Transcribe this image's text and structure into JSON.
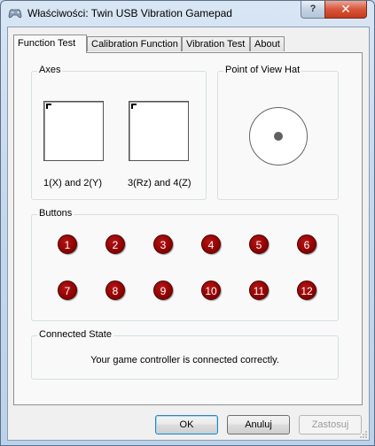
{
  "window": {
    "title": "Właściwości: Twin USB Vibration Gamepad",
    "help_label": "?",
    "close_label": "✕"
  },
  "tabs": [
    {
      "label": "Function Test",
      "active": true
    },
    {
      "label": "Calibration Function",
      "active": false
    },
    {
      "label": "Vibration Test",
      "active": false
    },
    {
      "label": "About",
      "active": false
    }
  ],
  "axes": {
    "title": "Axes",
    "axis1_label": "1(X) and 2(Y)",
    "axis2_label": "3(Rz) and 4(Z)"
  },
  "pov": {
    "title": "Point of View Hat"
  },
  "buttons": {
    "title": "Buttons",
    "items": [
      "1",
      "2",
      "3",
      "4",
      "5",
      "6",
      "7",
      "8",
      "9",
      "10",
      "11",
      "12"
    ]
  },
  "connected": {
    "title": "Connected State",
    "message": "Your game controller is connected correctly."
  },
  "footer": {
    "ok_label": "OK",
    "cancel_label": "Anuluj",
    "apply_label": "Zastosuj"
  },
  "colors": {
    "button_red": "#8a0000",
    "accent": "#3c7fb1"
  }
}
